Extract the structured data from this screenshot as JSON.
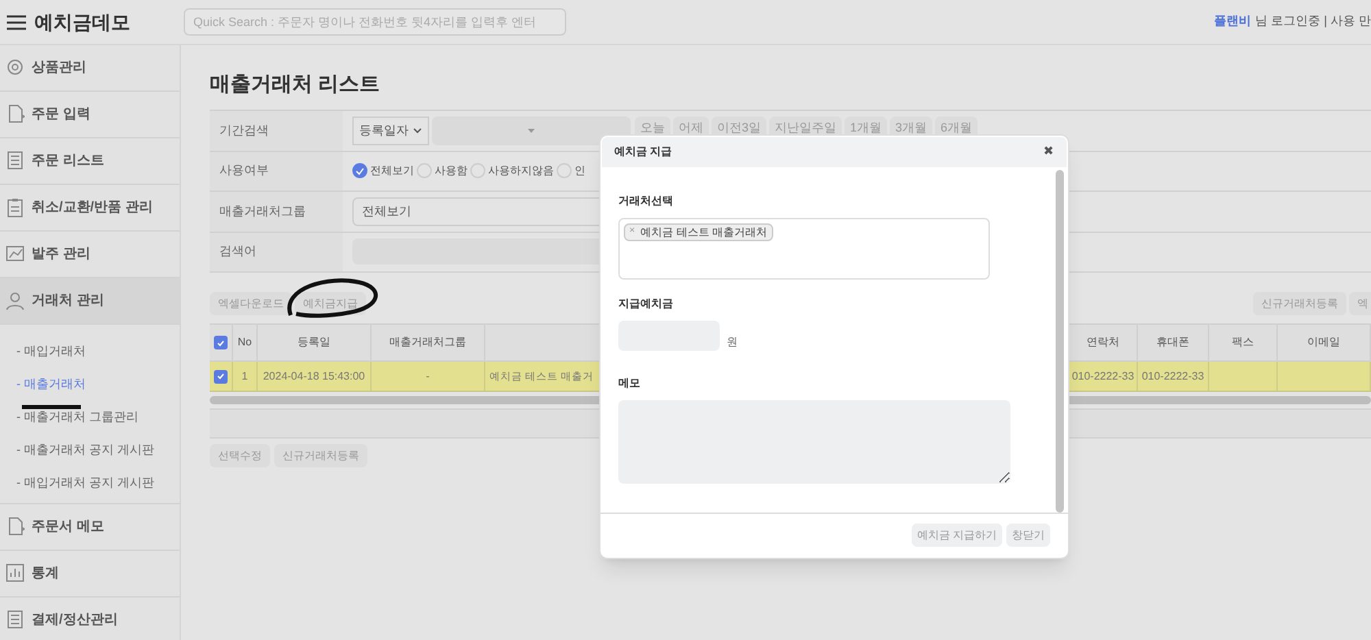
{
  "app": {
    "title": "예치금데모",
    "search_placeholder": "Quick Search : 주문자 명이나 전화번호 뒷4자리를 입력후 엔터",
    "user": "플랜비",
    "user_suffix": "님 로그인중 | 사용 만"
  },
  "sidebar": {
    "items": [
      {
        "label": "상품관리",
        "expanded": false
      },
      {
        "label": "주문 입력",
        "expanded": false
      },
      {
        "label": "주문 리스트",
        "expanded": false
      },
      {
        "label": "취소/교환/반품 관리",
        "expanded": false
      },
      {
        "label": "발주 관리",
        "expanded": false
      },
      {
        "label": "거래처 관리",
        "expanded": true,
        "children": [
          {
            "label": "- 매입거래처",
            "selected": false
          },
          {
            "label": "- 매출거래처",
            "selected": true
          },
          {
            "label": "- 매출거래처 그룹관리",
            "selected": false
          },
          {
            "label": "- 매출거래처 공지 게시판",
            "selected": false
          },
          {
            "label": "- 매입거래처 공지 게시판",
            "selected": false
          }
        ]
      },
      {
        "label": "주문서 메모",
        "expanded": false
      },
      {
        "label": "통계",
        "expanded": false
      },
      {
        "label": "결제/정산관리",
        "expanded": false
      }
    ]
  },
  "page_title": "매출거래처 리스트",
  "filters": [
    {
      "kind": "date",
      "label": "기간검색",
      "select_value": "등록일자",
      "quick": [
        "오늘",
        "어제",
        "이전3일",
        "지난일주일",
        "1개월",
        "3개월",
        "6개월"
      ]
    },
    {
      "kind": "radio",
      "label": "사용여부",
      "options": [
        {
          "label": "전체보기",
          "selected": true
        },
        {
          "label": "사용함",
          "selected": false
        },
        {
          "label": "사용하지않음",
          "selected": false
        },
        {
          "label": "인",
          "selected": false
        }
      ]
    },
    {
      "kind": "select",
      "label": "매출거래처그룹",
      "value": "전체보기"
    },
    {
      "kind": "text",
      "label": "검색어"
    }
  ],
  "toolbar": {
    "left": [
      "엑셀다운로드",
      "예치금지급"
    ],
    "right": [
      "신규거래처등록",
      "엑"
    ]
  },
  "table": {
    "columns": [
      "No",
      "등록일",
      "매출거래처그룹",
      "",
      "연락처",
      "휴대폰",
      "팩스",
      "이메일"
    ],
    "all_checked": true,
    "rows": [
      {
        "checked": true,
        "selected": true,
        "cells": [
          "1",
          "2024-04-18 15:43:00",
          "-",
          "예치금 테스트 매출거",
          "010-2222-33",
          "010-2222-33",
          "",
          ""
        ]
      }
    ]
  },
  "bottom_buttons": [
    "선택수정",
    "신규거래처등록"
  ],
  "modal": {
    "title": "예치금 지급",
    "close": "✖",
    "fields": [
      {
        "kind": "tags",
        "label": "거래처선택",
        "tags": [
          {
            "remove": "×",
            "label": "예치금 테스트 매출거래처"
          }
        ]
      },
      {
        "kind": "amount",
        "label": "지급예치금",
        "unit": "원"
      },
      {
        "kind": "textarea",
        "label": "메모"
      }
    ],
    "buttons": [
      "예치금 지급하기",
      "창닫기"
    ]
  }
}
